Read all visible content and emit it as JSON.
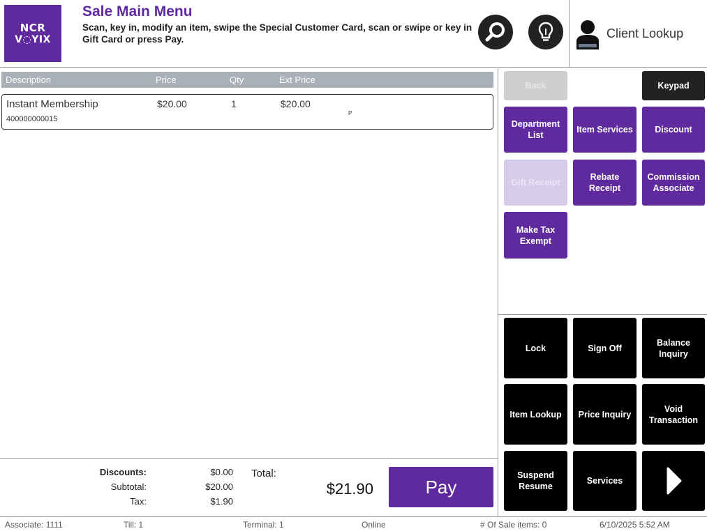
{
  "header": {
    "logo_line1": "NCR",
    "logo_line2": "V◌YIX",
    "title": "Sale Main Menu",
    "subtitle": "Scan, key in, modify an item, swipe the Special Customer Card, scan or swipe or key in Gift Card or press Pay.",
    "search_icon": "search-icon",
    "hint_icon": "lightbulb-icon",
    "client_lookup_label": "Client Lookup",
    "client_icon": "person-icon"
  },
  "colors": {
    "brand_purple": "#5e2a9e",
    "header_gray": "#a9b0b7",
    "black": "#000000",
    "dark_button": "#222222"
  },
  "list": {
    "columns": [
      "Description",
      "Price",
      "Qty",
      "Ext Price"
    ],
    "items": [
      {
        "description": "Instant Membership",
        "sku": "400000000015",
        "price": "$20.00",
        "qty": "1",
        "ext_price": "$20.00",
        "flag": "P"
      }
    ]
  },
  "totals": {
    "discounts_label": "Discounts:",
    "discounts_value": "$0.00",
    "subtotal_label": "Subtotal:",
    "subtotal_value": "$20.00",
    "tax_label": "Tax:",
    "tax_value": "$1.90",
    "total_label": "Total:",
    "total_value": "$21.90",
    "pay_label": "Pay"
  },
  "function_buttons": {
    "back": "Back",
    "keypad": "Keypad",
    "department_list": "Department List",
    "item_services": "Item Services",
    "discount": "Discount",
    "gift_receipt": "Gift Receipt",
    "rebate_receipt": "Rebate Receipt",
    "commission_associate": "Commission Associate",
    "make_tax_exempt": "Make Tax Exempt"
  },
  "system_buttons": {
    "lock": "Lock",
    "sign_off": "Sign Off",
    "balance_inquiry": "Balance Inquiry",
    "item_lookup": "Item Lookup",
    "price_inquiry": "Price Inquiry",
    "void_transaction": "Void Transaction",
    "suspend_resume": "Suspend Resume",
    "services": "Services",
    "next_icon": "arrow-right-icon"
  },
  "status_bar": {
    "associate": "Associate: 1111",
    "till": "Till: 1",
    "terminal": "Terminal: 1",
    "connection": "Online",
    "sale_items": "# Of Sale items: 0",
    "datetime": "6/10/2025 5:52 AM"
  }
}
